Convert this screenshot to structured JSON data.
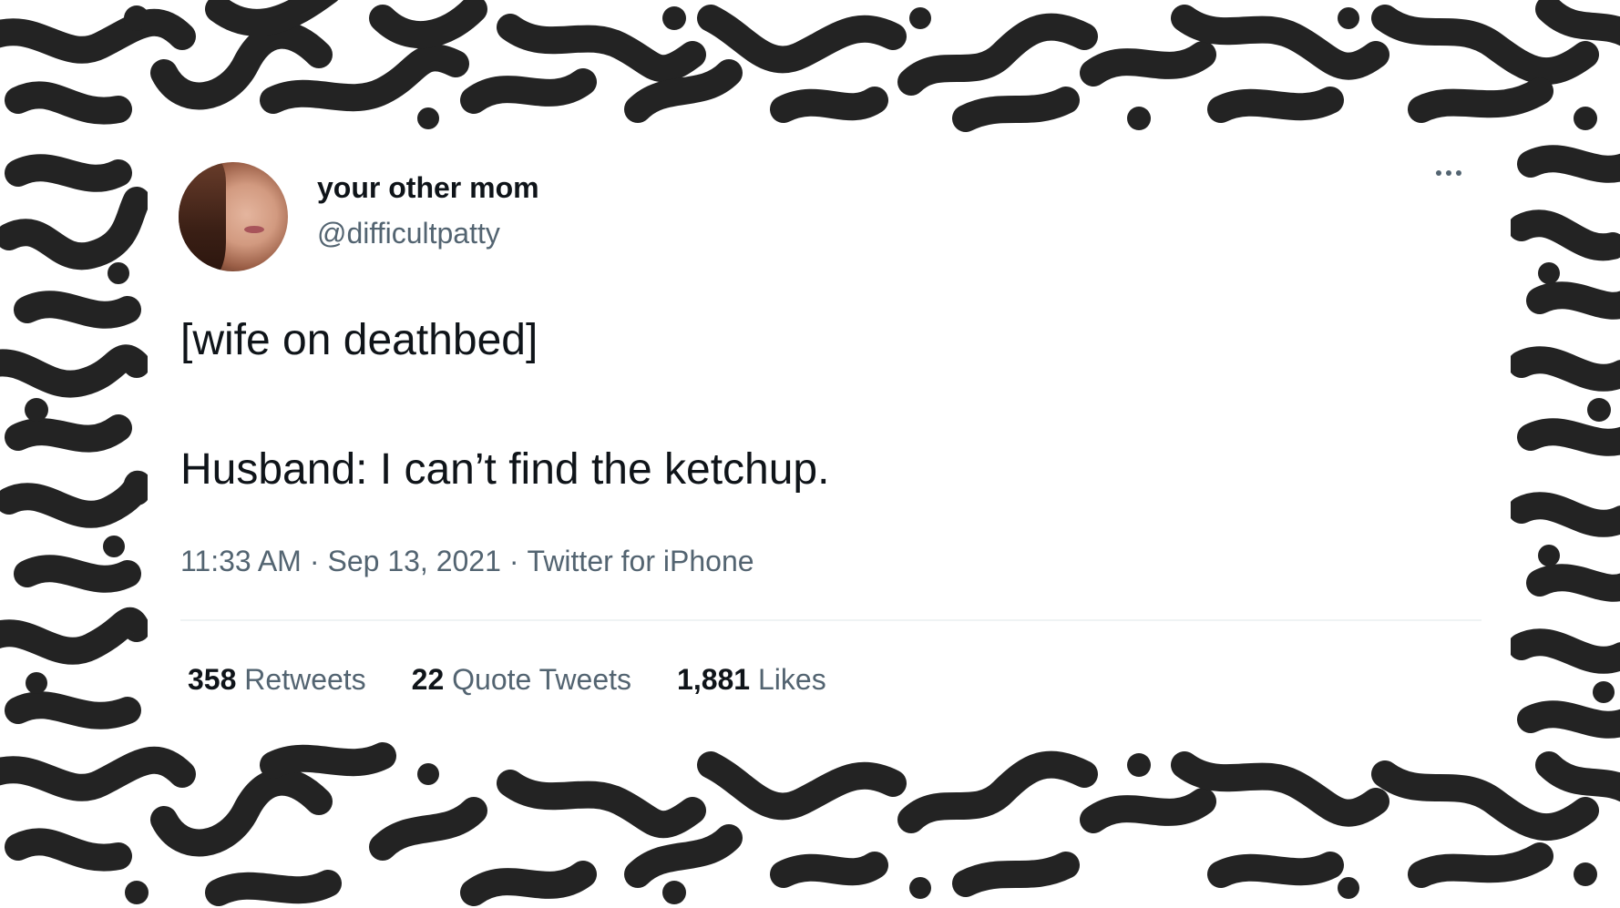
{
  "tweet": {
    "author": {
      "display_name": "your other mom",
      "handle": "@difficultpatty"
    },
    "text_lines": [
      "[wife on deathbed]",
      "Husband: I can’t find the ketchup."
    ],
    "time": "11:33 AM",
    "date": "Sep 13, 2021",
    "source": "Twitter for iPhone",
    "separator": "·",
    "stats": {
      "retweets": {
        "count": "358",
        "label": "Retweets"
      },
      "quote_tweets": {
        "count": "22",
        "label": "Quote Tweets"
      },
      "likes": {
        "count": "1,881",
        "label": "Likes"
      }
    }
  },
  "icons": {
    "more": "more-horizontal-icon"
  },
  "colors": {
    "pattern": "#232323",
    "card_background": "#ffffff",
    "primary_text": "#0f1419",
    "secondary_text": "#536471",
    "divider": "#eff3f4"
  }
}
